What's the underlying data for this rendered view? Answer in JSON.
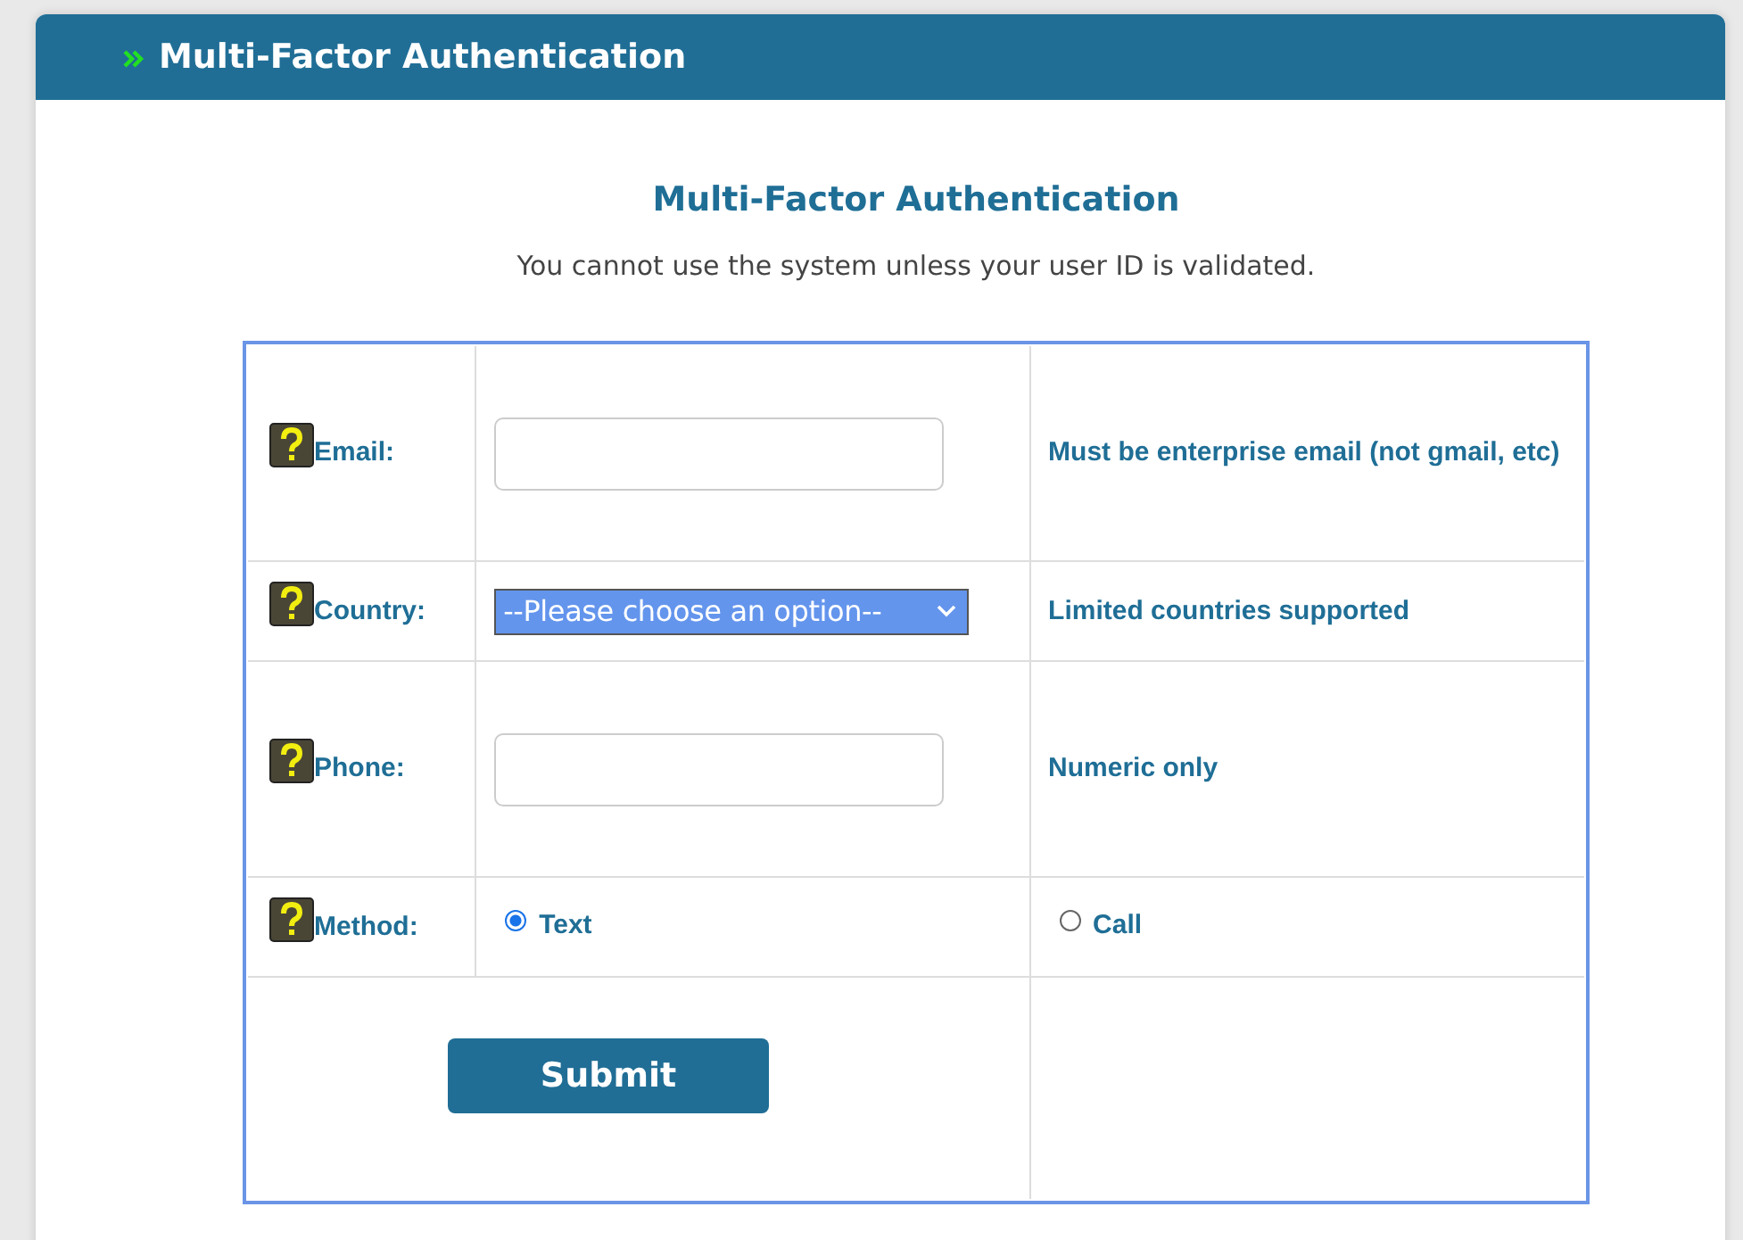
{
  "header": {
    "title": "Multi-Factor Authentication"
  },
  "heading": "Multi-Factor Authentication",
  "intro": "You cannot use the system unless your user ID is validated.",
  "rows": [
    {
      "kind": "input",
      "label": "Email:",
      "hint": "Must be enterprise email (not gmail, etc)"
    },
    {
      "kind": "select",
      "label": "Country:",
      "value": "--Please choose an option--",
      "hint": "Limited countries supported"
    },
    {
      "kind": "input",
      "label": "Phone:",
      "hint": "Numeric only"
    },
    {
      "kind": "radio",
      "label": "Method:",
      "options": [
        {
          "label": "Text",
          "selected": true
        },
        {
          "label": "Call",
          "selected": false
        }
      ]
    }
  ],
  "submit": "Submit"
}
